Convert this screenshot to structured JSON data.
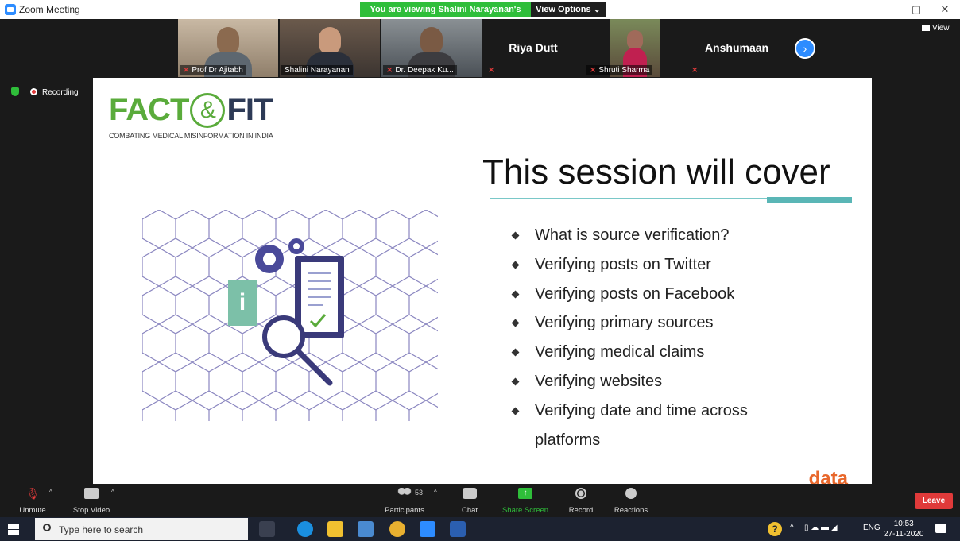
{
  "window": {
    "title": "Zoom Meeting",
    "viewing_banner": "You are viewing Shalini Narayanan's screen",
    "view_options": "View Options ⌄",
    "min": "–",
    "max": "▢",
    "close": "✕"
  },
  "participants": [
    {
      "name": "Prof Dr Ajitabh",
      "muted": true,
      "video": true
    },
    {
      "name": "Shalini Narayanan",
      "muted": false,
      "video": true,
      "active": true
    },
    {
      "name": "Dr. Deepak Ku...",
      "muted": true,
      "video": true
    },
    {
      "name": "Riya Dutt",
      "muted": true,
      "video": false
    },
    {
      "name": "Shruti Sharma",
      "muted": true,
      "video": true
    },
    {
      "name": "Anshumaan",
      "muted": true,
      "video": false
    }
  ],
  "view_button": "View",
  "recording_label": "Recording",
  "slide": {
    "logo_left": "FACT",
    "logo_amp": "&",
    "logo_right": "FIT",
    "logo_subtitle": "COMBATING MEDICAL MISINFORMATION IN INDIA",
    "title": "This session will cover",
    "bullets": [
      "What is source verification?",
      "Verifying posts on Twitter",
      "Verifying posts on Facebook",
      "Verifying primary sources",
      "Verifying medical claims",
      "Verifying websites",
      "Verifying date and time across"
    ],
    "bullet_continuation": "platforms",
    "footer_logo": "data"
  },
  "toolbar": {
    "unmute": "Unmute",
    "stop_video": "Stop Video",
    "participants": "Participants",
    "participant_count": "53",
    "chat": "Chat",
    "share_screen": "Share Screen",
    "record": "Record",
    "reactions": "Reactions",
    "leave": "Leave"
  },
  "taskbar": {
    "search_placeholder": "Type here to search",
    "lang": "ENG",
    "time": "10:53",
    "date": "27-11-2020"
  },
  "colors": {
    "accent_green": "#2fbe3a",
    "leave_red": "#e03a3a",
    "zoom_blue": "#2d8cff",
    "logo_green": "#5aab3b",
    "logo_navy": "#2d3a56"
  }
}
